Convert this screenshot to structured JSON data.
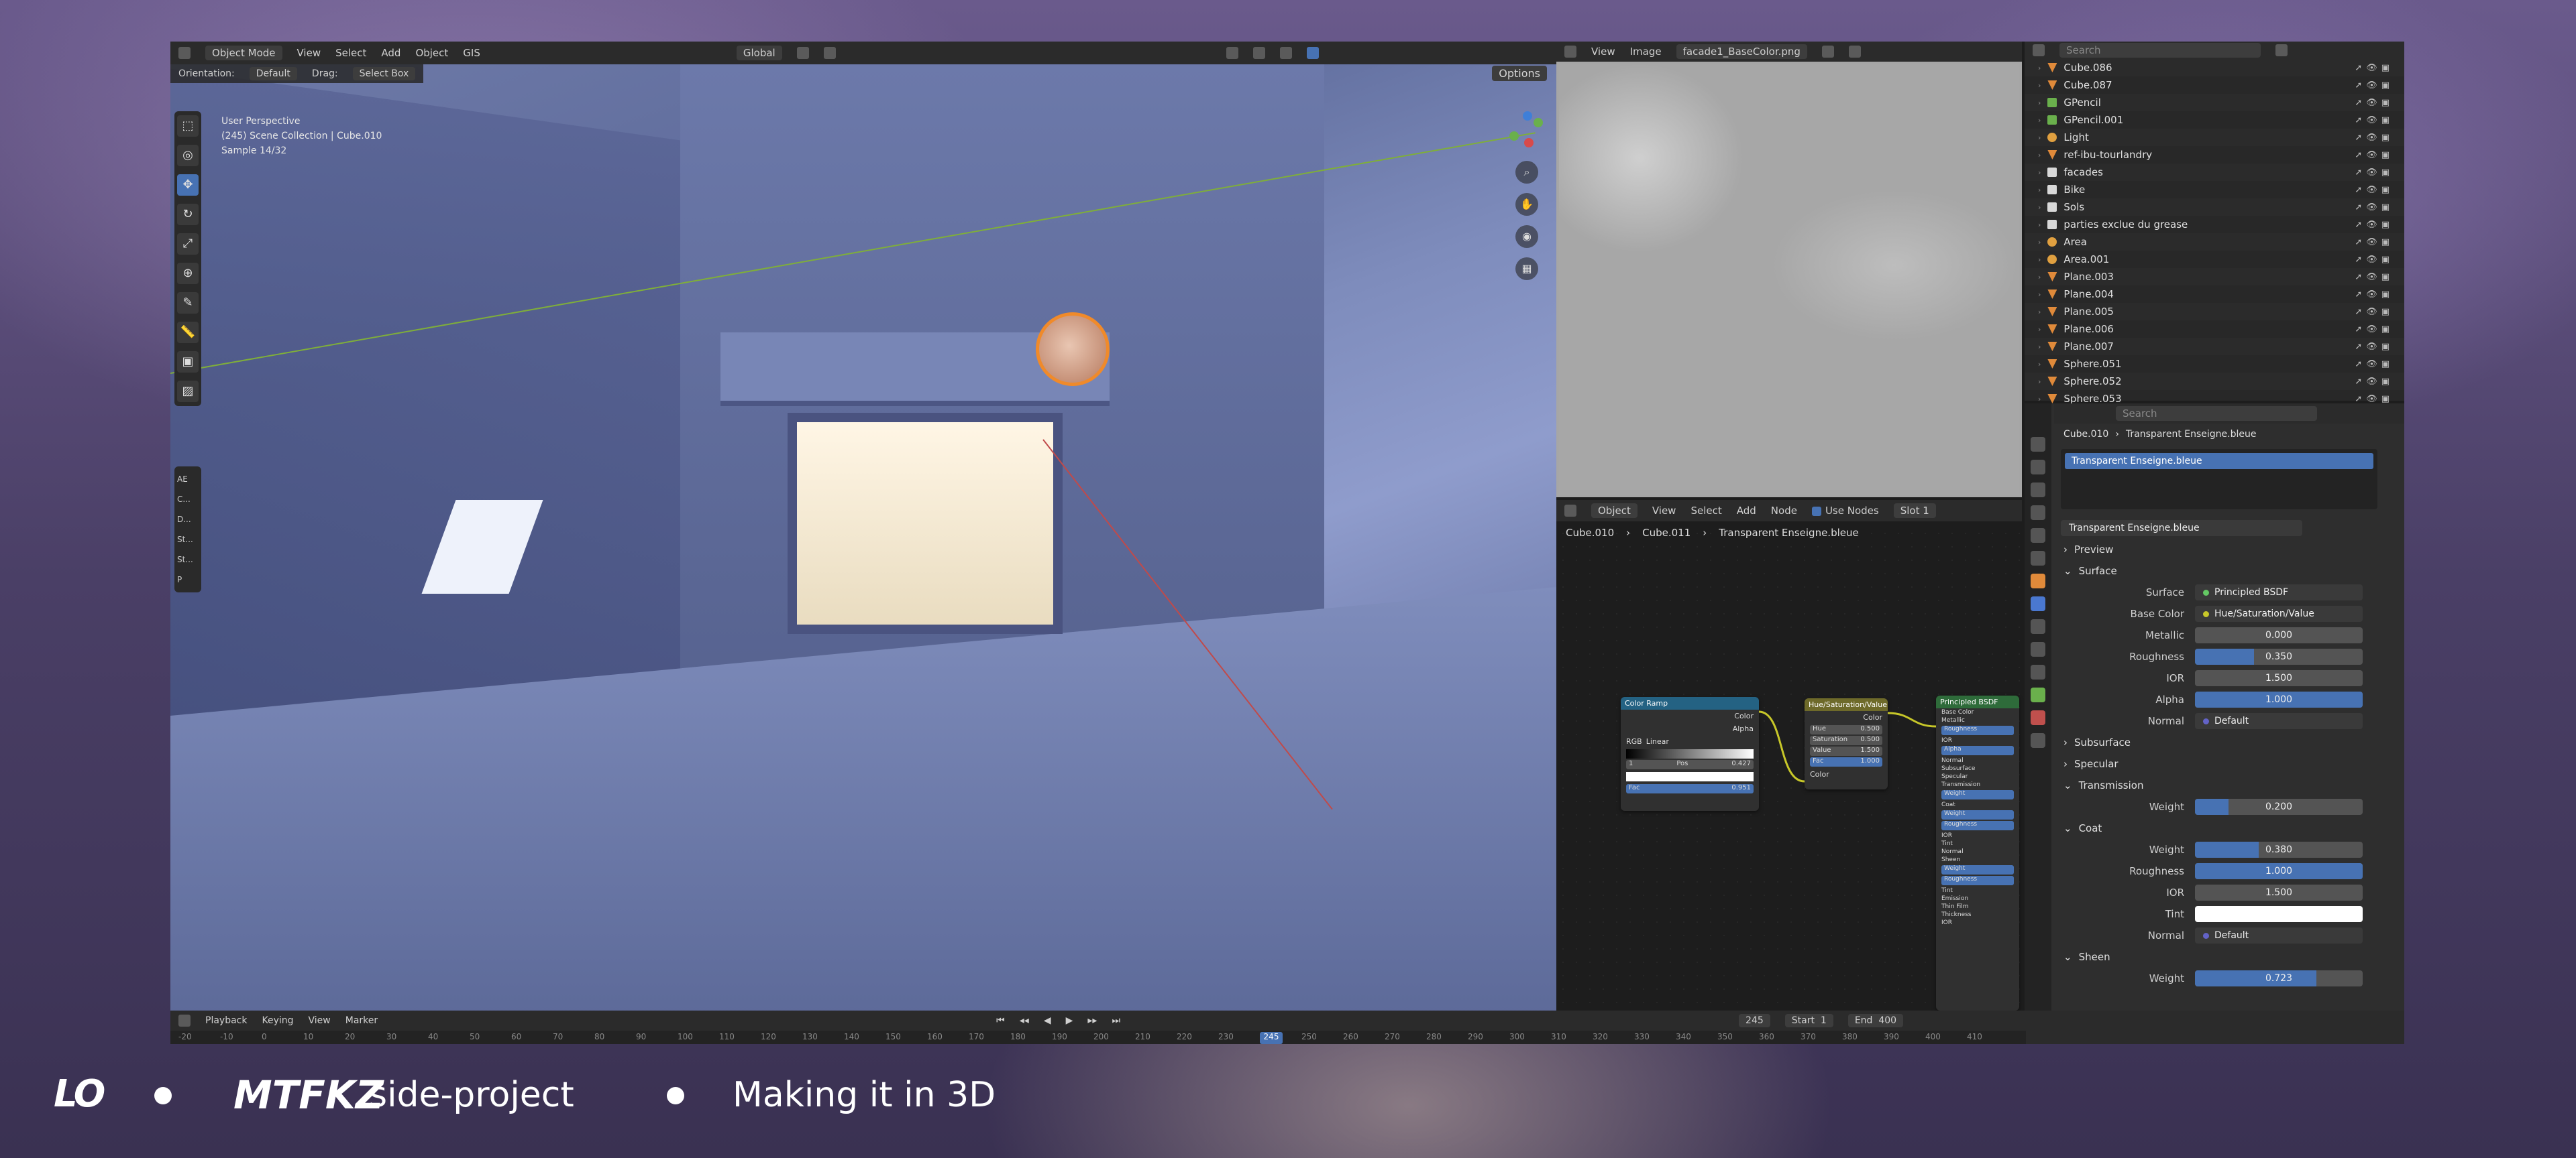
{
  "viewport": {
    "header": {
      "mode": "Object Mode",
      "menus": [
        "View",
        "Select",
        "Add",
        "Object",
        "GIS"
      ],
      "transform": "Global",
      "options": "Options"
    },
    "subheader": {
      "orientation_label": "Orientation:",
      "orientation_value": "Default",
      "drag_label": "Drag:",
      "drag_value": "Select Box"
    },
    "info": {
      "line1": "User Perspective",
      "line2": "(245) Scene Collection | Cube.010",
      "line3": "Sample 14/32"
    },
    "side_labels": [
      "AE",
      "C...",
      "D...",
      "St...",
      "St...",
      "P"
    ]
  },
  "image_editor": {
    "menus": [
      "View",
      "Image"
    ],
    "image_name": "facade1_BaseColor.png"
  },
  "node_editor": {
    "header": {
      "type": "Object",
      "menus": [
        "View",
        "Select",
        "Add",
        "Node"
      ],
      "use_nodes": "Use Nodes",
      "slot": "Slot 1"
    },
    "breadcrumb": [
      "Cube.010",
      "Cube.011",
      "Transparent Enseigne.bleue"
    ],
    "color_ramp": {
      "title": "Color Ramp",
      "out_color": "Color",
      "out_alpha": "Alpha",
      "mode": "RGB",
      "interp": "Linear",
      "pos_label": "Pos",
      "pos_value": "0.427",
      "index": "1",
      "fac_label": "Fac",
      "fac_value": "0.951"
    },
    "hsv": {
      "title": "Hue/Saturation/Value",
      "out": "Color",
      "fields": [
        [
          "Hue",
          "0.500"
        ],
        [
          "Saturation",
          "0.500"
        ],
        [
          "Value",
          "1.500"
        ],
        [
          "Fac",
          "1.000"
        ]
      ],
      "in": "Color"
    },
    "bsdf": {
      "title": "Principled BSDF",
      "rows": [
        "Base Color",
        "Metallic",
        "Roughness",
        "IOR",
        "Alpha",
        "Normal",
        "Subsurface",
        "Specular",
        "Transmission",
        "Weight",
        "Coat",
        "Weight",
        "Roughness",
        "IOR",
        "Tint",
        "Normal",
        "Sheen",
        "Weight",
        "Roughness",
        "Tint",
        "Emission",
        "Thin Film",
        "Thickness",
        "IOR"
      ]
    }
  },
  "outliner": {
    "search_placeholder": "Search",
    "rows": [
      {
        "name": "Cube.086",
        "type": "mesh"
      },
      {
        "name": "Cube.087",
        "type": "mesh"
      },
      {
        "name": "GPencil",
        "type": "gpencil"
      },
      {
        "name": "GPencil.001",
        "type": "gpencil"
      },
      {
        "name": "Light",
        "type": "light"
      },
      {
        "name": "ref-ibu-tourlandry",
        "type": "mesh"
      },
      {
        "name": "facades",
        "type": "collection"
      },
      {
        "name": "Bike",
        "type": "collection"
      },
      {
        "name": "Sols",
        "type": "collection"
      },
      {
        "name": "parties exclue du grease",
        "type": "collection"
      },
      {
        "name": "Area",
        "type": "light"
      },
      {
        "name": "Area.001",
        "type": "light"
      },
      {
        "name": "Plane.003",
        "type": "mesh"
      },
      {
        "name": "Plane.004",
        "type": "mesh"
      },
      {
        "name": "Plane.005",
        "type": "mesh"
      },
      {
        "name": "Plane.006",
        "type": "mesh"
      },
      {
        "name": "Plane.007",
        "type": "mesh"
      },
      {
        "name": "Sphere.051",
        "type": "mesh"
      },
      {
        "name": "Sphere.052",
        "type": "mesh"
      },
      {
        "name": "Sphere.053",
        "type": "mesh"
      }
    ]
  },
  "properties": {
    "search_placeholder": "Search",
    "breadcrumb": [
      "Cube.010",
      "Transparent Enseigne.bleue"
    ],
    "slot_selected": "Transparent Enseigne.bleue",
    "material_name": "Transparent Enseigne.bleue",
    "sections": {
      "preview": "Preview",
      "surface": "Surface",
      "subsurface": "Subsurface",
      "specular": "Specular",
      "transmission": "Transmission",
      "coat": "Coat",
      "sheen": "Sheen"
    },
    "surface": {
      "label": "Surface",
      "value": "Principled BSDF"
    },
    "base_color": {
      "label": "Base Color",
      "value": "Hue/Saturation/Value"
    },
    "metallic": {
      "label": "Metallic",
      "value": "0.000",
      "fraction": 0
    },
    "roughness": {
      "label": "Roughness",
      "value": "0.350",
      "fraction": 0.35
    },
    "ior": {
      "label": "IOR",
      "value": "1.500"
    },
    "alpha": {
      "label": "Alpha",
      "value": "1.000",
      "fraction": 1
    },
    "normal": {
      "label": "Normal",
      "value": "Default"
    },
    "trans_weight": {
      "label": "Weight",
      "value": "0.200",
      "fraction": 0.2
    },
    "coat_weight": {
      "label": "Weight",
      "value": "0.380",
      "fraction": 0.38
    },
    "coat_roughness": {
      "label": "Roughness",
      "value": "1.000",
      "fraction": 1
    },
    "coat_ior": {
      "label": "IOR",
      "value": "1.500"
    },
    "coat_tint": {
      "label": "Tint"
    },
    "coat_normal": {
      "label": "Normal",
      "value": "Default"
    },
    "sheen_weight": {
      "label": "Weight",
      "value": "0.723",
      "fraction": 0.723
    }
  },
  "timeline": {
    "menus": [
      "Playback",
      "Keying",
      "View",
      "Marker"
    ],
    "current_frame": "245",
    "start_label": "Start",
    "start": "1",
    "end_label": "End",
    "end": "400",
    "ruler": [
      "-20",
      "-10",
      "0",
      "10",
      "20",
      "30",
      "40",
      "50",
      "60",
      "70",
      "80",
      "90",
      "100",
      "110",
      "120",
      "130",
      "140",
      "150",
      "160",
      "170",
      "180",
      "190",
      "200",
      "210",
      "220",
      "230",
      "245",
      "250",
      "260",
      "270",
      "280",
      "290",
      "300",
      "310",
      "320",
      "330",
      "340",
      "350",
      "360",
      "370",
      "380",
      "390",
      "400",
      "410"
    ]
  },
  "footer": {
    "logo": "LO",
    "brand": "MTFKZ",
    "brand_suffix": " side-project",
    "tagline": "Making it in 3D"
  },
  "colors": {
    "accent": "#4772b3",
    "active_object": "#f08a2a"
  }
}
